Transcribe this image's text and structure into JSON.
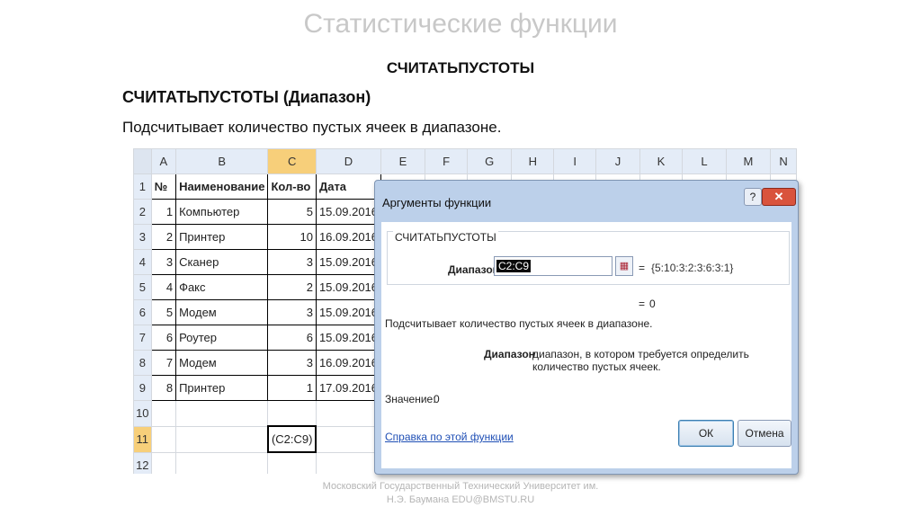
{
  "slide": {
    "title": "Статистические функции",
    "heading": "СЧИТАТЬПУСТОТЫ",
    "syntax": "СЧИТАТЬПУСТОТЫ (Диапазон)",
    "description": "Подсчитывает количество пустых ячеек в диапазоне.",
    "footer_line1": "Московский Государственный Технический Университет им.",
    "footer_line2": "Н.Э. Баумана EDU@BMSTU.RU"
  },
  "sheet": {
    "columns": [
      "A",
      "B",
      "C",
      "D",
      "E",
      "F",
      "G",
      "H",
      "I",
      "J",
      "K",
      "L",
      "M",
      "N"
    ],
    "selected_column": "C",
    "selected_row": "11",
    "rows": [
      {
        "num": "1",
        "a": "№",
        "b": "Наименование",
        "c": "Кол-во",
        "d": "Дата"
      },
      {
        "num": "2",
        "a": "1",
        "b": "Компьютер",
        "c": "5",
        "d": "15.09.2016"
      },
      {
        "num": "3",
        "a": "2",
        "b": "Принтер",
        "c": "10",
        "d": "16.09.2016"
      },
      {
        "num": "4",
        "a": "3",
        "b": "Сканер",
        "c": "3",
        "d": "15.09.2016"
      },
      {
        "num": "5",
        "a": "4",
        "b": "Факс",
        "c": "2",
        "d": "15.09.2016"
      },
      {
        "num": "6",
        "a": "5",
        "b": "Модем",
        "c": "3",
        "d": "15.09.2016"
      },
      {
        "num": "7",
        "a": "6",
        "b": "Роутер",
        "c": "6",
        "d": "15.09.2016"
      },
      {
        "num": "8",
        "a": "7",
        "b": "Модем",
        "c": "3",
        "d": "16.09.2016"
      },
      {
        "num": "9",
        "a": "8",
        "b": "Принтер",
        "c": "1",
        "d": "17.09.2016"
      },
      {
        "num": "10",
        "a": "",
        "b": "",
        "c": "",
        "d": ""
      },
      {
        "num": "11",
        "a": "",
        "b": "",
        "c": "(C2:C9)",
        "d": ""
      },
      {
        "num": "12",
        "a": "",
        "b": "",
        "c": "",
        "d": ""
      }
    ]
  },
  "dialog": {
    "title": "Аргументы функции",
    "help_glyph": "?",
    "close_glyph": "✕",
    "group_label": "СЧИТАТЬПУСТОТЫ",
    "arg_label": "Диапазон",
    "arg_value": "C2:C9",
    "arg_eq": "=",
    "arg_result": "{5:10:3:2:3:6:3:1}",
    "result_eq": "=",
    "result_value": "0",
    "fn_description": "Подсчитывает количество пустых ячеек в диапазоне.",
    "arg_desc_name": "Диапазон",
    "arg_desc_text": "диапазон, в котором требуется определить количество пустых ячеек.",
    "value_label": "Значение:",
    "value": "0",
    "help_link": "Справка по этой функции",
    "ok_label": "ОК",
    "cancel_label": "Отмена"
  }
}
